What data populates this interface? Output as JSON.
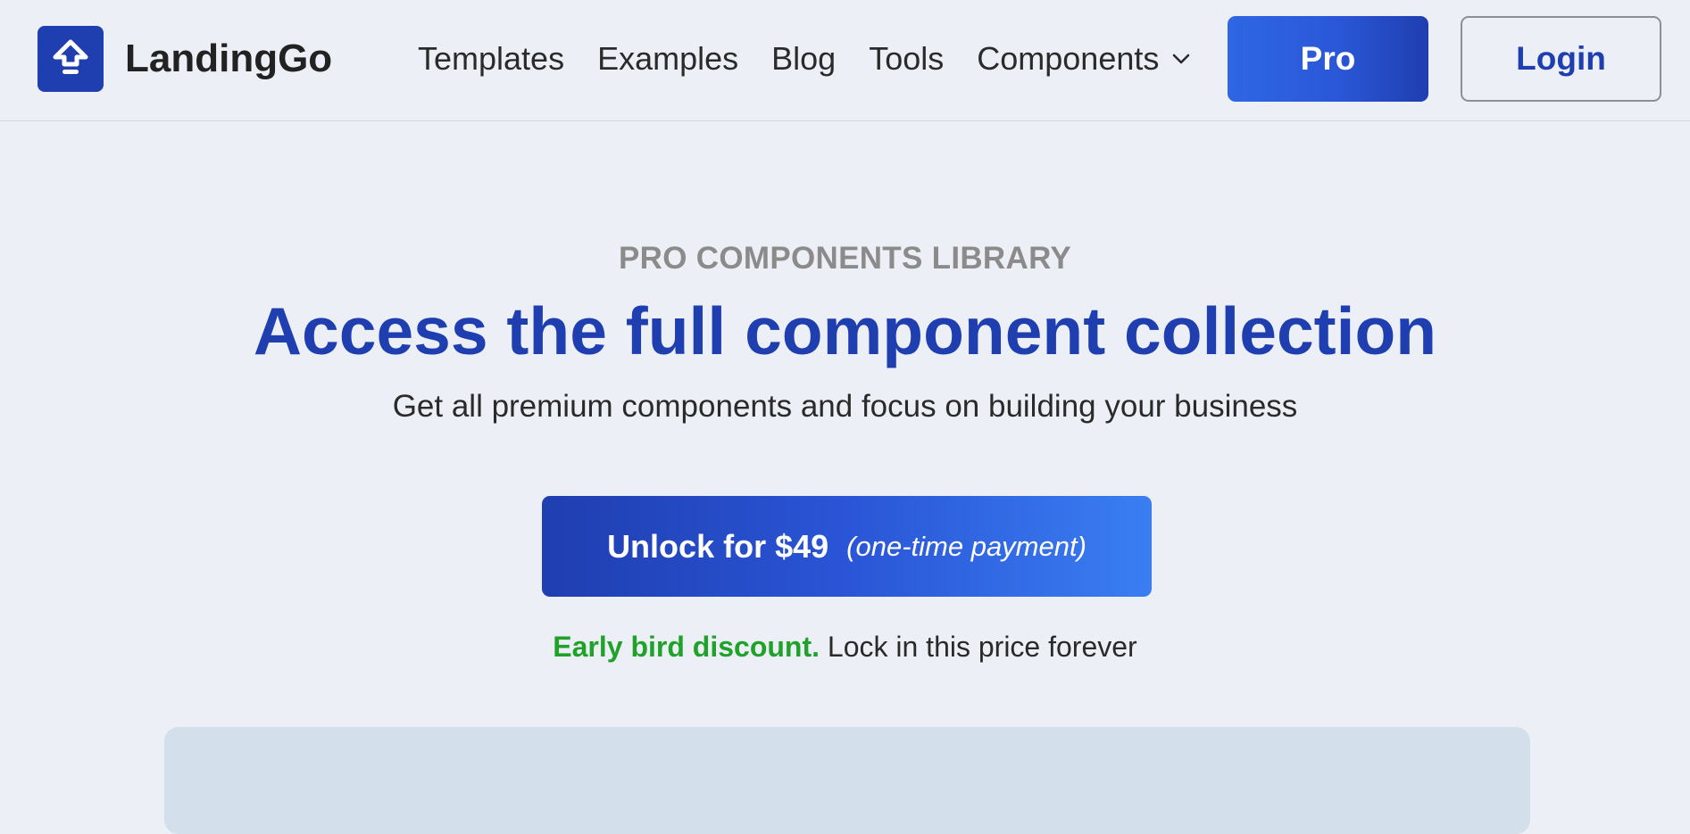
{
  "brand": {
    "name": "LandingGo",
    "logo_icon": "upload-arrow-icon",
    "logo_color": "#1f3eb0"
  },
  "nav": {
    "items": [
      {
        "label": "Templates"
      },
      {
        "label": "Examples"
      },
      {
        "label": "Blog"
      },
      {
        "label": "Tools"
      },
      {
        "label": "Components",
        "icon": "chevron-down-icon"
      }
    ]
  },
  "header_actions": {
    "pro_label": "Pro",
    "login_label": "Login"
  },
  "hero": {
    "eyebrow": "PRO COMPONENTS LIBRARY",
    "title": "Access the full component collection",
    "subtitle": "Get all premium components and focus on building your business",
    "cta_main": "Unlock for $49",
    "cta_sub": "(one-time payment)",
    "discount_strong": "Early bird discount.",
    "discount_rest": "Lock in this price forever"
  },
  "colors": {
    "accent": "#1f3eb0",
    "accent_light": "#3a7ef2",
    "discount_green": "#1fa12a",
    "background": "#ecf0f6"
  }
}
